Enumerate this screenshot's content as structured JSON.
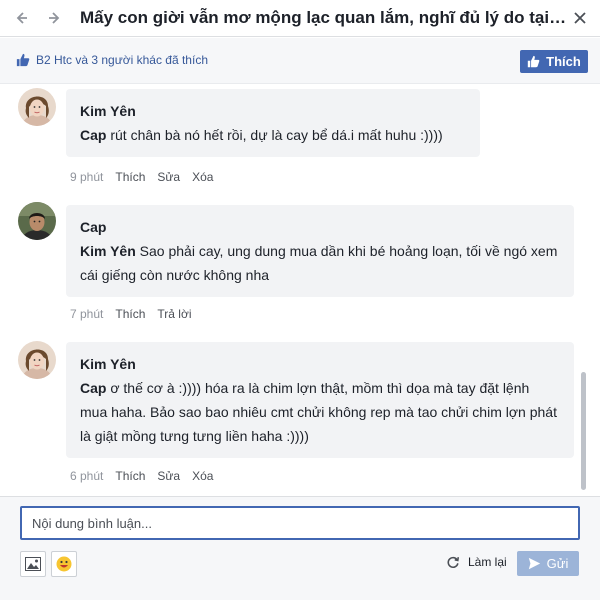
{
  "window": {
    "title": "Mấy con giời vẫn mơ mộng lạc quan lắm, nghĩ đủ lý do tại s...",
    "back_icon": "arrow-left-icon",
    "forward_icon": "arrow-right-icon",
    "close_icon": "close-icon"
  },
  "likes": {
    "summary": "B2 Htc và 3 người khác đã thích",
    "like_button": "Thích"
  },
  "comments": [
    {
      "author": "Kim Yên",
      "mention": "Cap",
      "text": " rút chân bà nó hết rồi, dự là cay bể dá.i mất huhu :))))",
      "time": "9 phút",
      "actions": [
        "Thích",
        "Sửa",
        "Xóa"
      ]
    },
    {
      "author": "Cap",
      "mention": "Kim Yên",
      "text": " Sao phải cay, ung dung mua dần khi bé hoảng loạn, tối về ngó xem cái giếng còn nước không nha",
      "time": "7 phút",
      "actions": [
        "Thích",
        "Trả lời"
      ]
    },
    {
      "author": "Kim Yên",
      "mention": "Cap",
      "text": " ơ thế cơ à :)))) hóa ra là chim lợn thật, mồm thì dọa mà tay đặt lệnh mua haha. Bảo sao bao nhiêu cmt chửi không rep mà tao chửi chim lợn phát là giật mồng tưng tưng liền haha :))))",
      "time": "6 phút",
      "actions": [
        "Thích",
        "Sửa",
        "Xóa"
      ]
    }
  ],
  "composer": {
    "placeholder": "Nội dung bình luận...",
    "value": "",
    "reset_label": "Làm lại",
    "send_label": "Gửi"
  },
  "colors": {
    "accent": "#4267b2",
    "link": "#365899",
    "bubble": "#f2f3f5",
    "send_disabled": "#9cb4d8"
  }
}
